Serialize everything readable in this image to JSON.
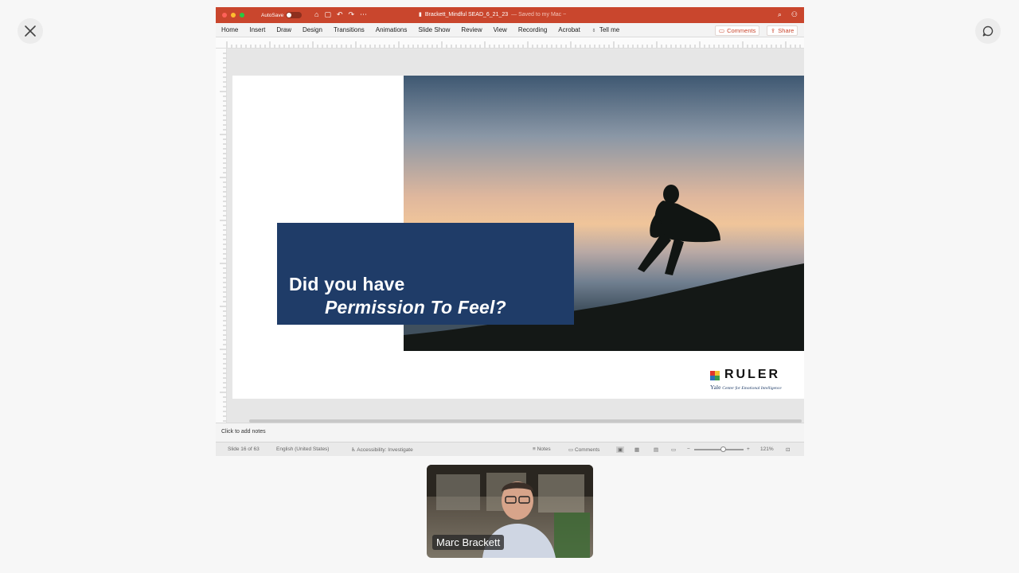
{
  "window": {
    "autosave_label": "AutoSave",
    "autosave_state": "OFF",
    "doc_name": "Brackett_Mindful SEAD_6_21_23",
    "save_status": "— Saved to my Mac ~"
  },
  "ribbon": {
    "tabs": [
      "Home",
      "Insert",
      "Draw",
      "Design",
      "Transitions",
      "Animations",
      "Slide Show",
      "Review",
      "View",
      "Recording",
      "Acrobat"
    ],
    "tell_me": "Tell me",
    "comments_label": "Comments",
    "share_label": "Share"
  },
  "slide": {
    "line1": "Did you have",
    "line2": "Permission To Feel?",
    "logo_word": "RULER",
    "logo_yale": "Yale",
    "logo_sub": "Center for Emotional Intelligence"
  },
  "notes": {
    "placeholder": "Click to add notes"
  },
  "status": {
    "slide_position": "Slide 16 of 63",
    "language": "English (United States)",
    "accessibility": "Accessibility: Investigate",
    "notes_label": "Notes",
    "comments_label": "Comments",
    "zoom_level": "121%",
    "zoom_fraction": 0.6
  },
  "participant": {
    "name": "Marc Brackett"
  },
  "colors": {
    "titlebar": "#c9462d",
    "title_box": "#1f3c68"
  }
}
